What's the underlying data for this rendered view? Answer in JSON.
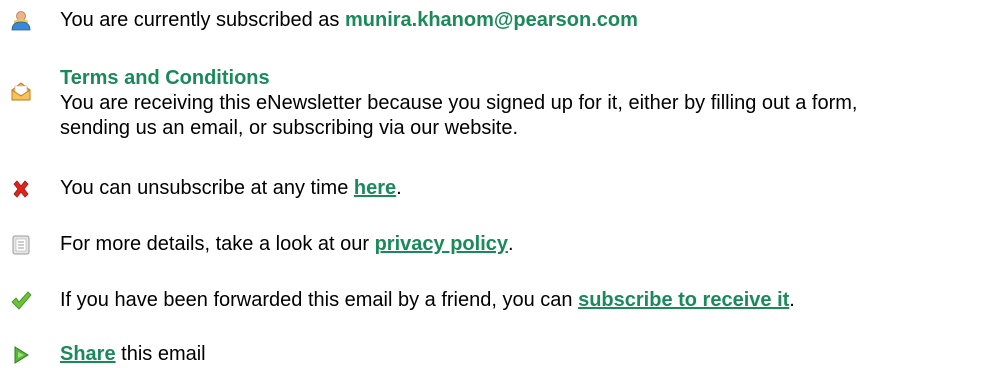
{
  "subscribed": {
    "prefix": "You are currently subscribed as ",
    "email": "munira.khanom@pearson.com"
  },
  "terms": {
    "heading": "Terms and Conditions",
    "body_line1": "You are receiving this eNewsletter because you signed up for it, either by filling out a form,",
    "body_line2": "sending us an email, or subscribing via our website."
  },
  "unsubscribe": {
    "prefix": "You can unsubscribe at any time ",
    "link": "here",
    "suffix": "."
  },
  "privacy": {
    "prefix": "For more details, take a look at our ",
    "link": "privacy policy",
    "suffix": "."
  },
  "forwarded": {
    "prefix": "If you have been forwarded this email by a friend, you can ",
    "link": "subscribe to receive it",
    "suffix": "."
  },
  "share": {
    "link": "Share",
    "suffix": " this email"
  },
  "colors": {
    "accent_green": "#1a8a5a"
  },
  "icons": {
    "subscriber": "user-icon",
    "terms": "open-envelope-icon",
    "unsubscribe": "red-x-icon",
    "privacy": "document-icon",
    "forwarded": "checkmark-icon",
    "share": "arrow-right-icon"
  }
}
